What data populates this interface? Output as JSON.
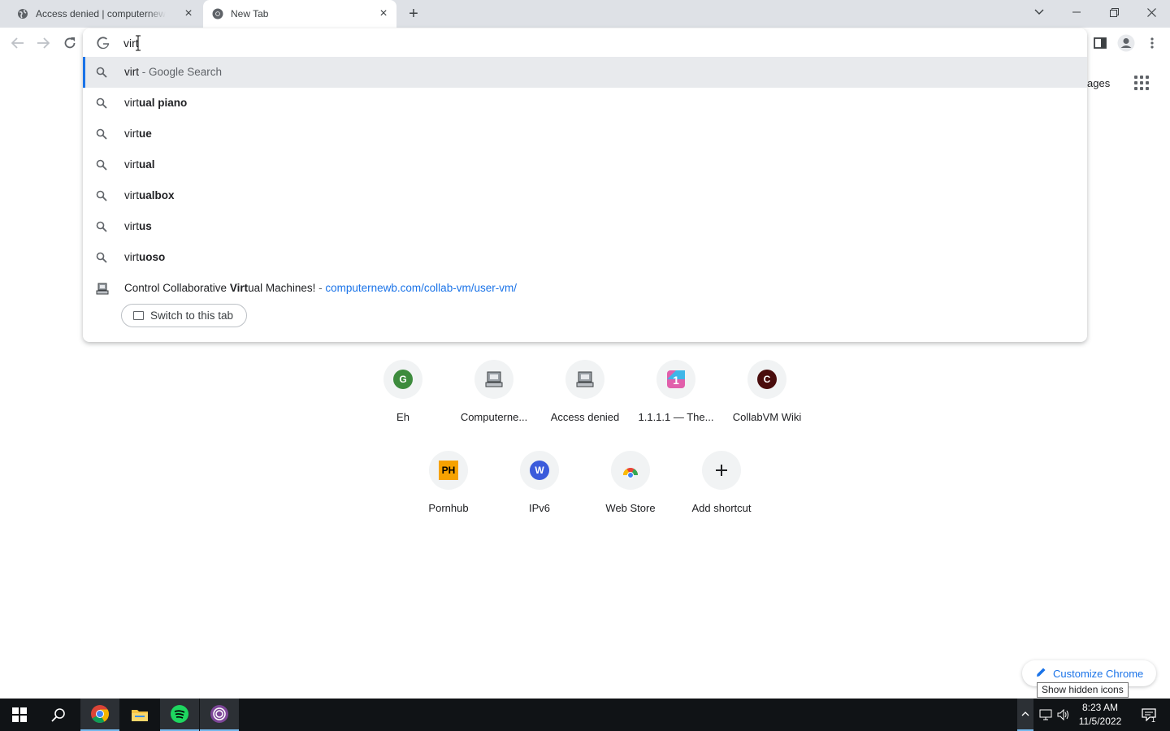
{
  "tabs": [
    {
      "title": "Access denied | computernewb.com",
      "active": false
    },
    {
      "title": "New Tab",
      "active": true
    }
  ],
  "omnibox": {
    "typed_text": "virt"
  },
  "suggestions": [
    {
      "prefix": "virt",
      "bold": "",
      "suffix": " - Google Search",
      "icon": "search-icon"
    },
    {
      "prefix": "virt",
      "bold": "ual piano",
      "suffix": "",
      "icon": "search-icon"
    },
    {
      "prefix": "virt",
      "bold": "ue",
      "suffix": "",
      "icon": "search-icon"
    },
    {
      "prefix": "virt",
      "bold": "ual",
      "suffix": "",
      "icon": "search-icon"
    },
    {
      "prefix": "virt",
      "bold": "ualbox",
      "suffix": "",
      "icon": "search-icon"
    },
    {
      "prefix": "virt",
      "bold": "us",
      "suffix": "",
      "icon": "search-icon"
    },
    {
      "prefix": "virt",
      "bold": "uoso",
      "suffix": "",
      "icon": "search-icon"
    }
  ],
  "history_suggestion": {
    "title_pre": "Control Collaborative ",
    "title_bold": "Virt",
    "title_post": "ual Machines!",
    "separator": " - ",
    "url": "computernewb.com/collab-vm/user-vm/",
    "switch_label": "Switch to this tab"
  },
  "ntp": {
    "images_link": "Images",
    "shortcuts_row1": [
      {
        "label": "Eh",
        "letter": "G",
        "color": "#3d8b3d"
      },
      {
        "label": "Computerne...",
        "icon": "computer-icon"
      },
      {
        "label": "Access denied",
        "icon": "computer-icon"
      },
      {
        "label": "1.1.1.1 — The...",
        "icon": "cloudflare-icon"
      },
      {
        "label": "CollabVM Wiki",
        "letter": "C",
        "color": "#4a0d0d"
      }
    ],
    "shortcuts_row2": [
      {
        "label": "Pornhub",
        "letter": "PH",
        "color": "#f6a200"
      },
      {
        "label": "IPv6",
        "letter": "W",
        "color": "#3b5bdb"
      },
      {
        "label": "Web Store",
        "icon": "webstore-icon"
      },
      {
        "label": "Add shortcut",
        "icon": "plus-icon"
      }
    ],
    "customize_label": "Customize Chrome"
  },
  "taskbar": {
    "tooltip": "Show hidden icons",
    "time": "8:23 AM",
    "date": "11/5/2022",
    "notification_count": "1"
  }
}
